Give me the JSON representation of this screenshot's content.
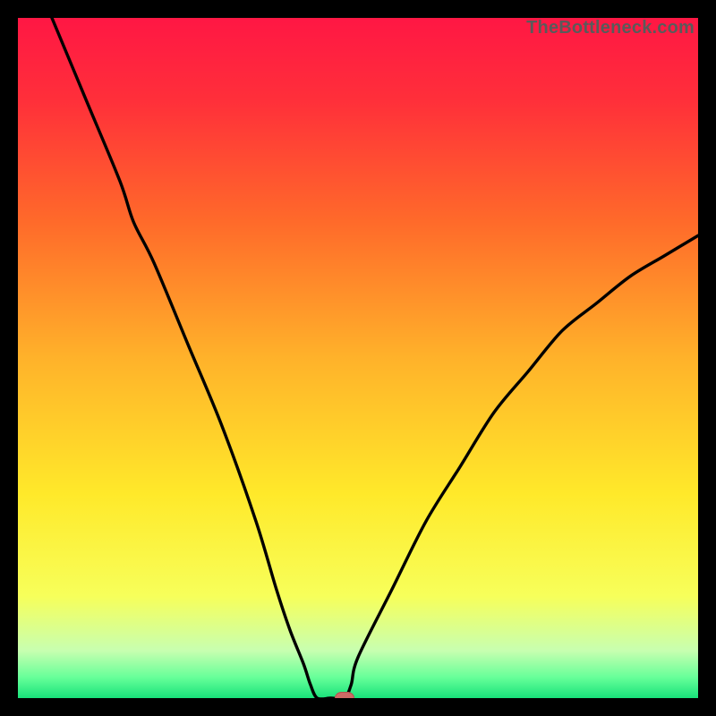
{
  "watermark": {
    "text": "TheBottleneck.com"
  },
  "colors": {
    "frame": "#000000",
    "gradient_stops": [
      {
        "pos": 0.0,
        "color": "#ff1744"
      },
      {
        "pos": 0.12,
        "color": "#ff2f3a"
      },
      {
        "pos": 0.3,
        "color": "#ff6a2a"
      },
      {
        "pos": 0.5,
        "color": "#ffb22a"
      },
      {
        "pos": 0.7,
        "color": "#ffe92a"
      },
      {
        "pos": 0.85,
        "color": "#f7ff5a"
      },
      {
        "pos": 0.93,
        "color": "#c8ffb0"
      },
      {
        "pos": 0.97,
        "color": "#66ff99"
      },
      {
        "pos": 1.0,
        "color": "#18e27a"
      }
    ],
    "curve": "#000000",
    "marker_fill": "#cf6a66",
    "marker_stroke": "#b3534f"
  },
  "chart_data": {
    "type": "line",
    "title": "",
    "xlabel": "",
    "ylabel": "",
    "xlim": [
      0,
      100
    ],
    "ylim": [
      0,
      100
    ],
    "series": [
      {
        "name": "bottleneck-curve",
        "x": [
          5,
          10,
          15,
          17,
          20,
          25,
          30,
          35,
          38,
          40,
          42,
          43,
          44,
          46,
          48,
          49,
          50,
          55,
          60,
          65,
          70,
          75,
          80,
          85,
          90,
          95,
          100
        ],
        "y": [
          100,
          88,
          76,
          70,
          64,
          52,
          40,
          26,
          16,
          10,
          5,
          2,
          0,
          0,
          0,
          2,
          6,
          16,
          26,
          34,
          42,
          48,
          54,
          58,
          62,
          65,
          68
        ]
      }
    ],
    "annotations": [
      {
        "name": "optimal-marker",
        "x": 48,
        "y": 0
      }
    ]
  }
}
